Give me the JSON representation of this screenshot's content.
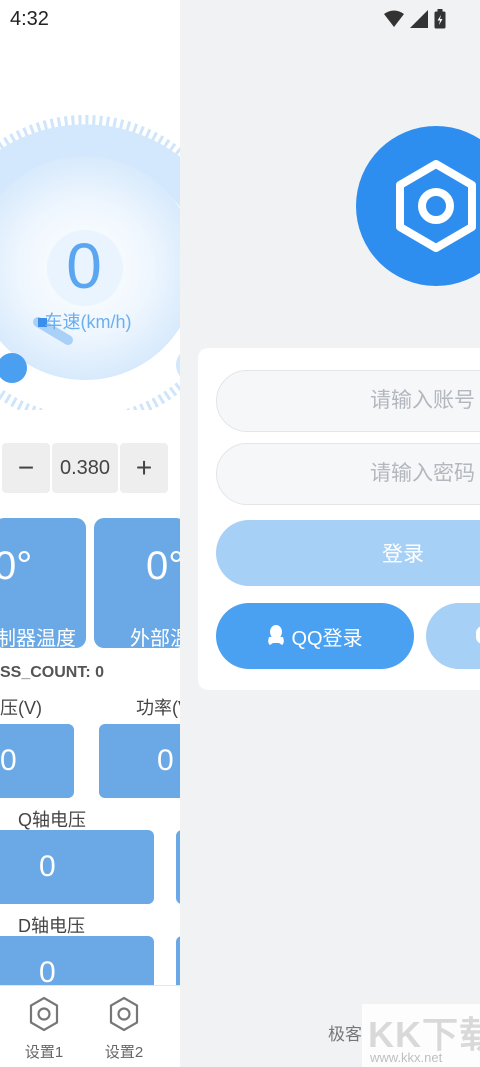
{
  "status_bar": {
    "time": "4:32"
  },
  "dashboard": {
    "speed": {
      "value": "0",
      "label": "车速(km/h)"
    },
    "stepper": {
      "minus": "−",
      "value": "0.380",
      "plus": "+"
    },
    "temps": [
      {
        "value": "0°",
        "label": "制器温度"
      },
      {
        "value": "0°",
        "label": "外部温"
      }
    ],
    "count_text": "SS_COUNT: 0",
    "voltage_label": "压(V)",
    "voltage_value": "0",
    "power_label": "功率(V",
    "power_value": "0",
    "q_axis_label": "Q轴电压",
    "q_axis_value": "0",
    "d_axis_label": "D轴电压",
    "d_axis_value": "0"
  },
  "nav": [
    {
      "label": "设置1",
      "icon": "hexagon-nut-icon"
    },
    {
      "label": "设置2",
      "icon": "hexagon-nut-icon"
    }
  ],
  "login": {
    "account_placeholder": "请输入账号",
    "password_placeholder": "请输入密码",
    "login_label": "登录",
    "qq_label": "QQ登录",
    "footer": "极客"
  },
  "watermark": {
    "logo": "KK下载",
    "url": "www.kkx.net"
  },
  "colors": {
    "accent": "#2d8ef0",
    "card_blue": "#6aa9e6",
    "light_blue": "#a7d0f7",
    "button_blue": "#4aa1f2"
  }
}
